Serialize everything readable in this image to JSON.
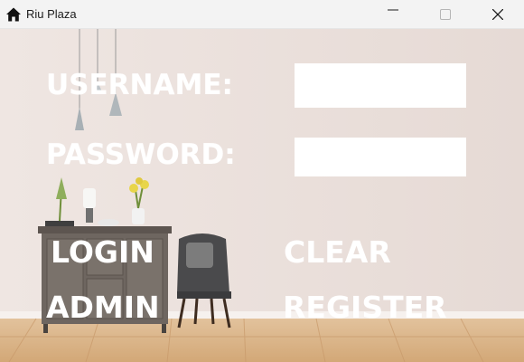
{
  "window": {
    "title": "Riu Plaza",
    "icon": "home-icon",
    "controls": [
      "minimize-icon",
      "maximize-icon",
      "close-icon"
    ]
  },
  "form": {
    "username_label": "USERNAME:",
    "username_value": "",
    "password_label": "PASSWORD:",
    "password_value": ""
  },
  "buttons": {
    "login": "LOGIN",
    "clear": "CLEAR",
    "admin": "ADMIN",
    "register": "REGISTER"
  },
  "colors": {
    "wall": "#e9dfdb",
    "floor": "#d9b48a",
    "text": "#ffffff"
  }
}
